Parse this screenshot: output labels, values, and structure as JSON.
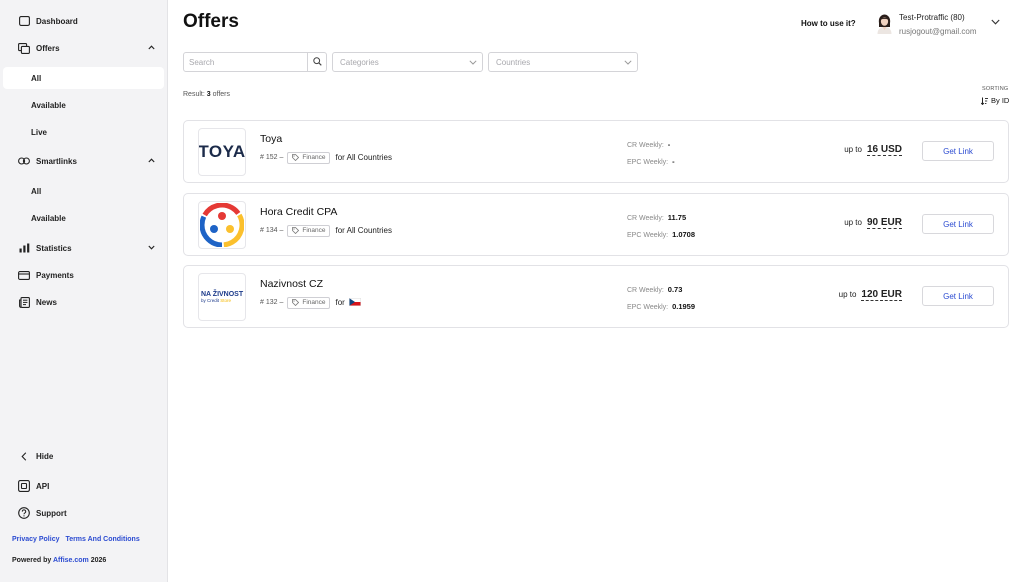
{
  "sidebar": {
    "dashboard": "Dashboard",
    "offers": "Offers",
    "offers_sub": {
      "all": "All",
      "available": "Available",
      "live": "Live"
    },
    "smartlinks": "Smartlinks",
    "smartlinks_sub": {
      "all": "All",
      "available": "Available"
    },
    "statistics": "Statistics",
    "payments": "Payments",
    "news": "News",
    "hide": "Hide",
    "api": "API",
    "support": "Support",
    "privacy_policy": "Privacy Policy",
    "terms": "Terms And Conditions",
    "powered_prefix": "Powered by",
    "powered_link": "Affise.com",
    "powered_year": "2026"
  },
  "header": {
    "title": "Offers",
    "how_to": "How to use it?",
    "user_name": "Test-Protraffic (80)",
    "user_email": "rusjogout@gmail.com"
  },
  "filters": {
    "search_placeholder": "Search",
    "categories_placeholder": "Categories",
    "countries_placeholder": "Countries"
  },
  "result": {
    "prefix": "Result:",
    "count": "3",
    "suffix": "offers"
  },
  "sorting": {
    "label": "SORTING",
    "value": "By ID"
  },
  "offers": [
    {
      "name": "Toya",
      "id": "# 152 –",
      "category": "Finance",
      "geo": "for All Countries",
      "cr_label": "CR Weekly:",
      "cr_value": "-",
      "epc_label": "EPC Weekly:",
      "epc_value": "-",
      "payout_prefix": "up to",
      "payout_amount": "16 USD",
      "button": "Get Link",
      "logo_text": "TOYA"
    },
    {
      "name": "Hora Credit CPA",
      "id": "# 134 –",
      "category": "Finance",
      "geo": "for All Countries",
      "cr_label": "CR Weekly:",
      "cr_value": "11.75",
      "epc_label": "EPC Weekly:",
      "epc_value": "1.0708",
      "payout_prefix": "up to",
      "payout_amount": "90 EUR",
      "button": "Get Link"
    },
    {
      "name": "Nazivnost CZ",
      "id": "# 132 –",
      "category": "Finance",
      "geo": "for",
      "cr_label": "CR Weekly:",
      "cr_value": "0.73",
      "epc_label": "EPC Weekly:",
      "epc_value": "0.1959",
      "payout_prefix": "up to",
      "payout_amount": "120 EUR",
      "button": "Get Link",
      "logo_line1": "NA ŽIVNOST",
      "logo_line2": "by Credit",
      "logo_line2b": "Store"
    }
  ],
  "colors": {
    "accent": "#2b4bd1",
    "sidebar_bg": "#f3f3f5"
  }
}
